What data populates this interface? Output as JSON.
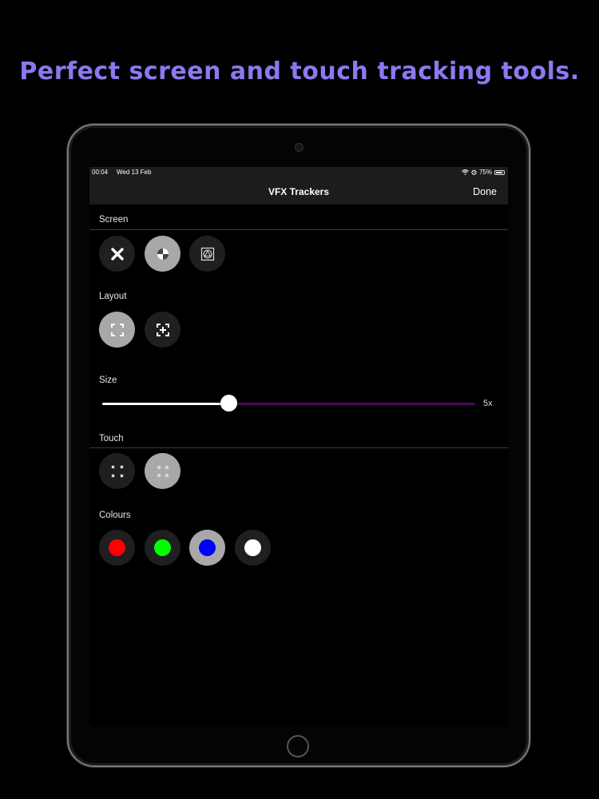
{
  "headline": "Perfect screen and touch tracking tools.",
  "colors": {
    "headline": "#8d78f0",
    "slider_fill": "#ffffff",
    "slider_track": "#4b0a5a"
  },
  "statusbar": {
    "time": "00:04",
    "date": "Wed 13 Feb",
    "battery": "75%"
  },
  "navbar": {
    "title": "VFX Trackers",
    "done_label": "Done"
  },
  "sections": {
    "screen": {
      "label": "Screen",
      "options": [
        {
          "icon": "close-x-icon",
          "selected": false
        },
        {
          "icon": "reference-ball-icon",
          "selected": true
        },
        {
          "icon": "tracking-marker-icon",
          "selected": false
        }
      ]
    },
    "layout": {
      "label": "Layout",
      "options": [
        {
          "icon": "corner-frame-icon",
          "selected": true
        },
        {
          "icon": "center-frame-icon",
          "selected": false
        }
      ]
    },
    "size": {
      "label": "Size",
      "value": 5,
      "value_label": "5x",
      "min": 1,
      "max": 25
    },
    "touch": {
      "label": "Touch",
      "options": [
        {
          "icon": "x-grid-icon",
          "selected": false
        },
        {
          "icon": "dot-grid-icon",
          "selected": true
        }
      ]
    },
    "colours": {
      "label": "Colours",
      "options": [
        {
          "color": "#ff0000",
          "selected": false
        },
        {
          "color": "#00ff00",
          "selected": false
        },
        {
          "color": "#0000ff",
          "selected": true
        },
        {
          "color": "#ffffff",
          "selected": false
        }
      ]
    }
  }
}
